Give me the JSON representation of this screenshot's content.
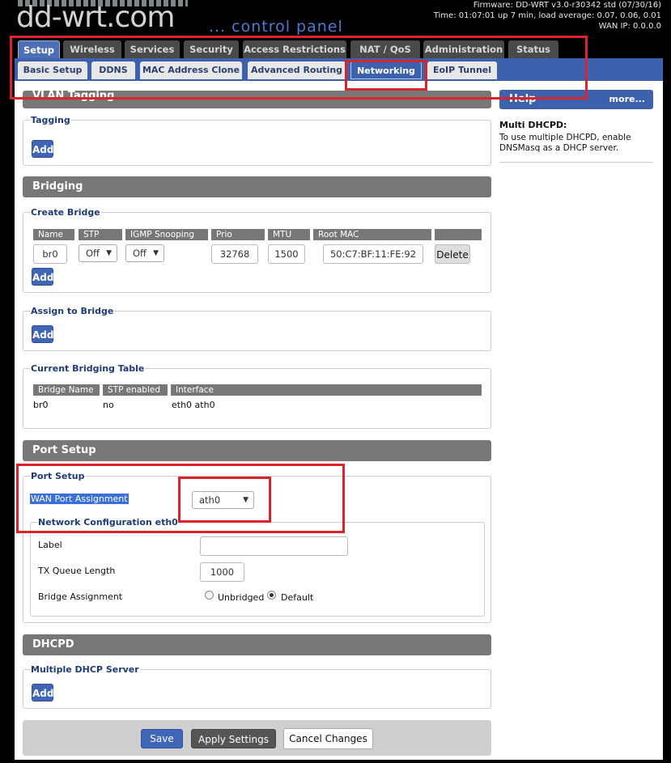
{
  "header": {
    "logo_text": "dd-wrt.com",
    "panel_title": "... control panel",
    "firmware": "Firmware: DD-WRT v3.0-r30342 std (07/30/16)",
    "time": "Time: 01:07:01 up 7 min, load average: 0.07, 0.06, 0.01",
    "wan_ip": "WAN IP: 0.0.0.0"
  },
  "tabs": [
    {
      "label": "Setup",
      "active": true
    },
    {
      "label": "Wireless"
    },
    {
      "label": "Services"
    },
    {
      "label": "Security"
    },
    {
      "label": "Access Restrictions"
    },
    {
      "label": "NAT / QoS"
    },
    {
      "label": "Administration"
    },
    {
      "label": "Status"
    }
  ],
  "subtabs": [
    {
      "label": "Basic Setup"
    },
    {
      "label": "DDNS"
    },
    {
      "label": "MAC Address Clone"
    },
    {
      "label": "Advanced Routing"
    },
    {
      "label": "Networking",
      "active": true
    },
    {
      "label": "EoIP Tunnel"
    }
  ],
  "vlan": {
    "section_title": "VLAN Tagging",
    "tagging_title": "Tagging",
    "add_label": "Add"
  },
  "bridging": {
    "section_title": "Bridging",
    "create_title": "Create Bridge",
    "columns": [
      "Name",
      "STP",
      "IGMP Snooping",
      "Prio",
      "MTU",
      "Root MAC"
    ],
    "row": {
      "name": "br0",
      "stp": "Off",
      "igmp": "Off",
      "prio": "32768",
      "mtu": "1500",
      "root_mac": "50:C7:BF:11:FE:92",
      "delete_label": "Delete"
    },
    "add_label": "Add",
    "assign_title": "Assign to Bridge",
    "assign_add_label": "Add",
    "table_title": "Current Bridging Table",
    "table_columns": [
      "Bridge Name",
      "STP enabled",
      "Interface"
    ],
    "table_rows": [
      [
        "br0",
        "no",
        "eth0 ath0"
      ]
    ]
  },
  "port_setup": {
    "section_title": "Port Setup",
    "box_title": "Port Setup",
    "wan_label": "WAN Port Assignment",
    "wan_value": "ath0",
    "net_config_title": "Network Configuration eth0",
    "label_label": "Label",
    "label_value": "",
    "txq_label": "TX Queue Length",
    "txq_value": "1000",
    "bridge_label": "Bridge Assignment",
    "opt_unbridged": "Unbridged",
    "opt_default": "Default",
    "selected": "Default"
  },
  "dhcpd": {
    "section_title": "DHCPD",
    "box_title": "Multiple DHCP Server",
    "add_label": "Add"
  },
  "help": {
    "title": "Help",
    "more": "more...",
    "heading": "Multi DHCPD:",
    "text": "To use multiple DHCPD, enable DNSMasq as a DHCP server."
  },
  "footer": {
    "save": "Save",
    "apply": "Apply Settings",
    "cancel": "Cancel Changes"
  },
  "colors": {
    "accent_blue": "#3e61ad",
    "section_gray": "#777777",
    "annotation_red": "#d9252a"
  }
}
